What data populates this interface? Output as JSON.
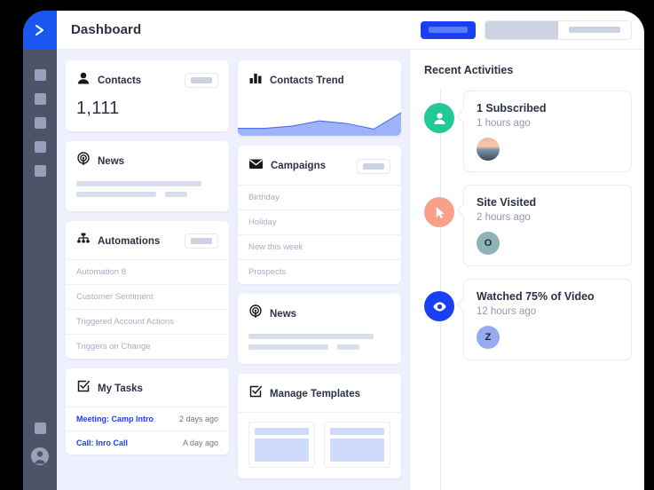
{
  "sidebar": {
    "logo_icon": "chevron-right-logo-icon",
    "nav_items": [
      {
        "icon": "nav-square-icon"
      },
      {
        "icon": "nav-square-icon"
      },
      {
        "icon": "nav-square-icon"
      },
      {
        "icon": "nav-square-icon"
      },
      {
        "icon": "nav-square-icon"
      }
    ],
    "bottom_items": [
      {
        "icon": "nav-square-icon"
      },
      {
        "icon": "user-avatar-icon"
      }
    ]
  },
  "topbar": {
    "title": "Dashboard",
    "primary_button_label": "",
    "segmented": {
      "left_label": "",
      "right_label": ""
    }
  },
  "dashboard": {
    "contacts": {
      "title": "Contacts",
      "icon": "person-icon",
      "value": "1,111",
      "action_label": ""
    },
    "news_left": {
      "title": "News",
      "icon": "broadcast-icon"
    },
    "automations": {
      "title": "Automations",
      "icon": "automation-hierarchy-icon",
      "action_label": "",
      "items": [
        "Automation 8",
        "Customer Sentiment",
        "Triggered Account Actions",
        "Triggers on Change"
      ]
    },
    "my_tasks": {
      "title": "My Tasks",
      "icon": "checkbox-check-icon",
      "tasks": [
        {
          "name": "Meeting: Camp Intro",
          "time": "2 days ago"
        },
        {
          "name": "Call: Inro Call",
          "time": "A day ago"
        }
      ]
    },
    "contacts_trend": {
      "title": "Contacts Trend",
      "icon": "bar-chart-icon"
    },
    "campaigns": {
      "title": "Campaigns",
      "icon": "envelope-icon",
      "action_label": "",
      "items": [
        "Birthday",
        "Holiday",
        "New this week",
        "Prospects"
      ]
    },
    "news_right": {
      "title": "News",
      "icon": "broadcast-icon"
    },
    "manage_templates": {
      "title": "Manage Templates",
      "icon": "checkbox-check-icon",
      "templates": [
        {
          "name": "template-thumb"
        },
        {
          "name": "template-thumb"
        }
      ]
    }
  },
  "chart_data": {
    "type": "area",
    "title": "Contacts Trend",
    "xlabel": "",
    "ylabel": "",
    "x": [
      0,
      1,
      2,
      3,
      4,
      5,
      6
    ],
    "values": [
      20,
      20,
      26,
      40,
      33,
      18,
      62
    ],
    "ylim": [
      0,
      100
    ],
    "grid": false,
    "legend": "none",
    "line_color": "#4a6ef5",
    "fill_color": "#9fb4f7"
  },
  "activities": {
    "title": "Recent Activities",
    "items": [
      {
        "icon": "person-icon",
        "icon_color": "#22c896",
        "headline": "1 Subscribed",
        "time": "1 hours ago",
        "avatar_type": "photo",
        "avatar_label": ""
      },
      {
        "icon": "cursor-arrow-icon",
        "icon_color": "#f8a188",
        "headline": "Site Visited",
        "time": "2 hours ago",
        "avatar_type": "initial",
        "avatar_label": "O"
      },
      {
        "icon": "eye-icon",
        "icon_color": "#1a40f5",
        "headline": "Watched 75% of Video",
        "time": "12 hours ago",
        "avatar_type": "initial",
        "avatar_label": "Z"
      }
    ]
  }
}
